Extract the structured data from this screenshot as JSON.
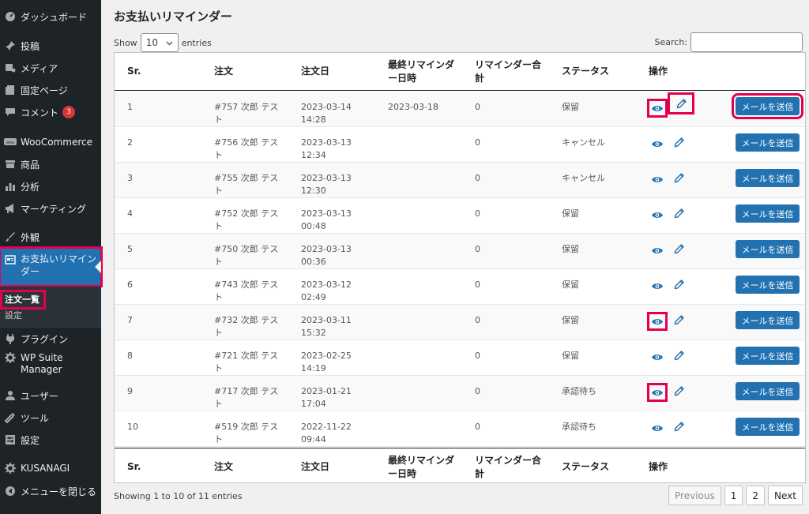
{
  "sidebar": {
    "items": [
      {
        "key": "dashboard",
        "label": "ダッシュボード",
        "icon": "dashboard-icon"
      },
      {
        "key": "posts",
        "label": "投稿",
        "icon": "pin-icon"
      },
      {
        "key": "media",
        "label": "メディア",
        "icon": "media-icon"
      },
      {
        "key": "pages",
        "label": "固定ページ",
        "icon": "page-icon"
      },
      {
        "key": "comments",
        "label": "コメント",
        "icon": "comment-icon",
        "badge": "3"
      },
      {
        "key": "woocommerce",
        "label": "WooCommerce",
        "icon": "woo-icon"
      },
      {
        "key": "products",
        "label": "商品",
        "icon": "archive-icon"
      },
      {
        "key": "analytics",
        "label": "分析",
        "icon": "chart-bar-icon"
      },
      {
        "key": "marketing",
        "label": "マーケティング",
        "icon": "megaphone-icon"
      },
      {
        "key": "appearance",
        "label": "外観",
        "icon": "brush-icon"
      },
      {
        "key": "payment_reminder",
        "label": "お支払いリマインダー",
        "icon": "card-icon"
      },
      {
        "key": "plugins",
        "label": "プラグイン",
        "icon": "plugin-icon"
      },
      {
        "key": "wpsuite",
        "label": "WP Suite Manager",
        "icon": "gear-icon"
      },
      {
        "key": "users",
        "label": "ユーザー",
        "icon": "user-icon"
      },
      {
        "key": "tools",
        "label": "ツール",
        "icon": "wrench-icon"
      },
      {
        "key": "settings",
        "label": "設定",
        "icon": "settings-icon"
      },
      {
        "key": "kusanagi",
        "label": "KUSANAGI",
        "icon": "gear-icon"
      },
      {
        "key": "collapse",
        "label": "メニューを閉じる",
        "icon": "collapse-icon"
      }
    ],
    "submenu": [
      {
        "label": "注文一覧",
        "current": true
      },
      {
        "label": "設定",
        "current": false
      }
    ]
  },
  "page": {
    "title": "お支払いリマインダー",
    "show_label": "Show",
    "entries_label": "entries",
    "length_value": "10",
    "search_label": "Search:",
    "search_value": ""
  },
  "table": {
    "columns": [
      "Sr.",
      "注文",
      "注文日",
      "最終リマインダー日時",
      "リマインダー合計",
      "ステータス",
      "操作"
    ],
    "rows": [
      {
        "sr": "1",
        "order": "#757 次郎 テスト",
        "date": "2023-03-14 14:28",
        "last": "2023-03-18",
        "count": "0",
        "status": "保留"
      },
      {
        "sr": "2",
        "order": "#756 次郎 テスト",
        "date": "2023-03-13 12:34",
        "last": "",
        "count": "0",
        "status": "キャンセル"
      },
      {
        "sr": "3",
        "order": "#755 次郎 テスト",
        "date": "2023-03-13 12:30",
        "last": "",
        "count": "0",
        "status": "キャンセル"
      },
      {
        "sr": "4",
        "order": "#752 次郎 テスト",
        "date": "2023-03-13 00:48",
        "last": "",
        "count": "0",
        "status": "保留"
      },
      {
        "sr": "5",
        "order": "#750 次郎 テスト",
        "date": "2023-03-13 00:36",
        "last": "",
        "count": "0",
        "status": "保留"
      },
      {
        "sr": "6",
        "order": "#743 次郎 テスト",
        "date": "2023-03-12 02:49",
        "last": "",
        "count": "0",
        "status": "保留"
      },
      {
        "sr": "7",
        "order": "#732 次郎 テスト",
        "date": "2023-03-11 15:32",
        "last": "",
        "count": "0",
        "status": "保留"
      },
      {
        "sr": "8",
        "order": "#721 次郎 テスト",
        "date": "2023-02-25 14:19",
        "last": "",
        "count": "0",
        "status": "保留"
      },
      {
        "sr": "9",
        "order": "#717 次郎 テスト",
        "date": "2023-01-21 17:04",
        "last": "",
        "count": "0",
        "status": "承認待ち"
      },
      {
        "sr": "10",
        "order": "#519 次郎 テスト",
        "date": "2022-11-22 09:44",
        "last": "",
        "count": "0",
        "status": "承認待ち"
      }
    ],
    "send_label": "メールを送信"
  },
  "footer": {
    "info": "Showing 1 to 10 of 11 entries",
    "previous": "Previous",
    "pages": [
      "1",
      "2"
    ],
    "next": "Next"
  },
  "colors": {
    "sidebar_bg": "#1d2327",
    "accent": "#2271b1",
    "highlight": "#e5004f",
    "badge": "#d63638"
  }
}
